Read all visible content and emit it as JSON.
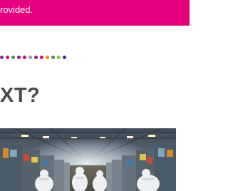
{
  "banner": {
    "line1": "",
    "line2": "rovided.",
    "bg_color": "#e6007e"
  },
  "divider": {
    "dot_colors": [
      "#7b2a8a",
      "#e6007e",
      "#5e8e3e",
      "#7b2a8a",
      "#e6007e",
      "#9a9a9a",
      "#7b2a8a",
      "#e6007e",
      "#f28c00",
      "#5e8e3e",
      "#9ac43c",
      "#1f3c88"
    ]
  },
  "section": {
    "heading": "XT?"
  },
  "image": {
    "subject": "factory-floor-workers"
  }
}
